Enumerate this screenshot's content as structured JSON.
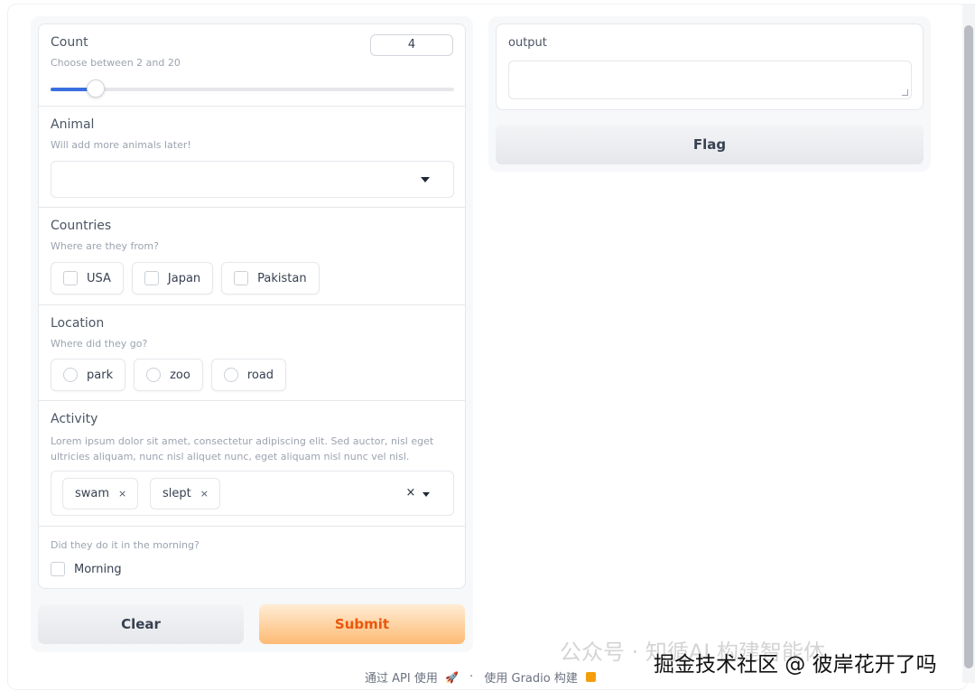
{
  "count": {
    "label": "Count",
    "info": "Choose between 2 and 20",
    "value": "4",
    "min": 2,
    "max": 20,
    "slider_fraction": 0.111
  },
  "animal": {
    "label": "Animal",
    "info": "Will add more animals later!",
    "value": ""
  },
  "countries": {
    "label": "Countries",
    "info": "Where are they from?",
    "options": [
      "USA",
      "Japan",
      "Pakistan"
    ]
  },
  "location": {
    "label": "Location",
    "info": "Where did they go?",
    "options": [
      "park",
      "zoo",
      "road"
    ]
  },
  "activity": {
    "label": "Activity",
    "info": "Lorem ipsum dolor sit amet, consectetur adipiscing elit. Sed auctor, nisl eget ultricies aliquam, nunc nisl aliquet nunc, eget aliquam nisl nunc vel nisl.",
    "selected": [
      "swam",
      "slept"
    ],
    "token_remove": "×",
    "clear_all": "×"
  },
  "morning": {
    "info": "Did they do it in the morning?",
    "label": "Morning",
    "checked": false
  },
  "buttons": {
    "clear": "Clear",
    "submit": "Submit",
    "flag": "Flag"
  },
  "output": {
    "label": "output",
    "value": ""
  },
  "footer": {
    "api": "通过 API 使用",
    "separator": "·",
    "built_with": "使用 Gradio 构建"
  },
  "watermark": {
    "faded": "公众号 · 知循AI 构建智能体",
    "strong": "掘金技术社区 @ 彼岸花开了吗"
  },
  "colors": {
    "accent": "#3b6fe0",
    "submit_text": "#ea580c",
    "submit_bg": "#fdba74"
  }
}
